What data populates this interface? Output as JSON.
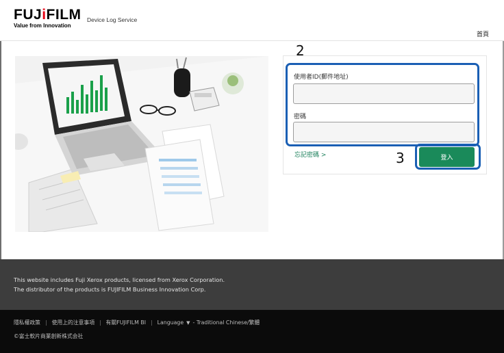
{
  "header": {
    "logo_text_a": "FUJ",
    "logo_text_dot": "i",
    "logo_text_b": "FILM",
    "logo_tagline": "Value from Innovation",
    "service_name": "Device Log Service",
    "home_link": "首頁"
  },
  "annotations": {
    "step_fields": "2",
    "step_login": "3"
  },
  "login": {
    "user_label": "使用者ID(郵件地址)",
    "user_value": "",
    "password_label": "密碼",
    "password_value": "",
    "forgot_link": "忘記密碼",
    "forgot_chevron": ">",
    "login_button": "登入"
  },
  "footer": {
    "disclaimer_line1": "This website includes Fuji Xerox products, licensed from Xerox Corporation.",
    "disclaimer_line2": "The distributor of the products is FUJIFILM Business Innovation Corp.",
    "links": [
      "隱私權政策",
      "使用上的注意事項",
      "有關FUJIFILM BI"
    ],
    "language_label": "Language",
    "language_value": "- Traditional Chinese/繁體",
    "separator": "|",
    "copyright": "©富士軟片商業創新株式会社"
  },
  "colors": {
    "accent_green": "#1a8a5a",
    "highlight_blue": "#1a5fb4",
    "logo_red": "#e60012"
  }
}
